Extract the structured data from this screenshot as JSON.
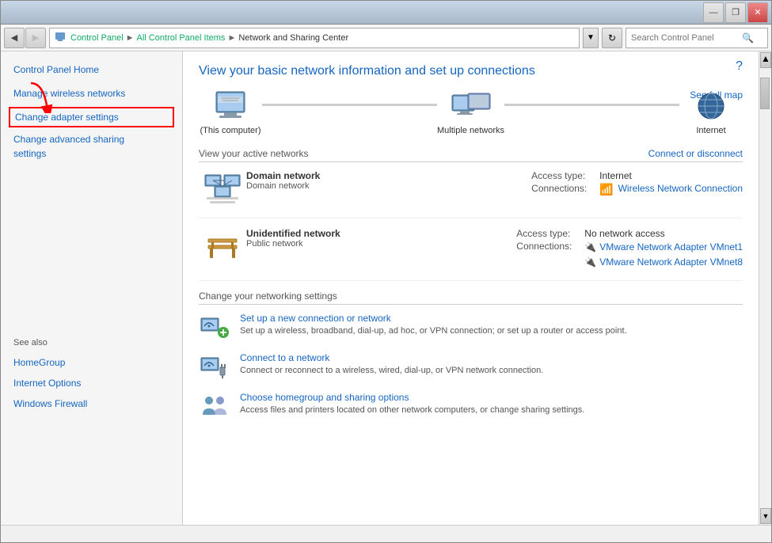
{
  "window": {
    "title": "Network and Sharing Center",
    "buttons": {
      "minimize": "—",
      "maximize": "□",
      "close": "✕",
      "restore": "❐"
    }
  },
  "addressbar": {
    "breadcrumb": [
      "Control Panel",
      "All Control Panel Items",
      "Network and Sharing Center"
    ],
    "search_placeholder": "Search Control Panel"
  },
  "sidebar": {
    "nav_items": [
      {
        "label": "Control Panel Home",
        "id": "control-panel-home"
      },
      {
        "label": "Manage wireless networks",
        "id": "manage-wireless"
      },
      {
        "label": "Change adapter settings",
        "id": "change-adapter",
        "highlighted": true
      },
      {
        "label": "Change advanced sharing\nsettings",
        "id": "change-advanced"
      }
    ],
    "see_also_title": "See also",
    "see_also_items": [
      {
        "label": "HomeGroup",
        "id": "homegroup"
      },
      {
        "label": "Internet Options",
        "id": "internet-options"
      },
      {
        "label": "Windows Firewall",
        "id": "windows-firewall"
      }
    ]
  },
  "content": {
    "title": "View your basic network information and set up connections",
    "see_full_map": "See full map",
    "network_diagram": {
      "items": [
        {
          "label": "(This computer)",
          "type": "computer"
        },
        {
          "label": "Multiple networks",
          "type": "multiple"
        },
        {
          "label": "Internet",
          "type": "internet"
        }
      ]
    },
    "active_networks_header": "View your active networks",
    "connect_or_disconnect": "Connect or disconnect",
    "networks": [
      {
        "name": "Domain network",
        "type": "Domain network",
        "icon": "domain",
        "access_type": "Internet",
        "connection_type": "Wireless Network Connection",
        "connection_icon": "wifi"
      },
      {
        "name": "Unidentified network",
        "type": "Public network",
        "icon": "public",
        "access_type": "No network access",
        "connections": [
          "VMware Network Adapter VMnet1",
          "VMware Network Adapter VMnet8"
        ]
      }
    ],
    "settings_header": "Change your networking settings",
    "settings": [
      {
        "id": "new-connection",
        "link": "Set up a new connection or network",
        "desc": "Set up a wireless, broadband, dial-up, ad hoc, or VPN connection; or set up a router or access point.",
        "icon": "new-connection"
      },
      {
        "id": "connect-network",
        "link": "Connect to a network",
        "desc": "Connect or reconnect to a wireless, wired, dial-up, or VPN network connection.",
        "icon": "connect-network"
      },
      {
        "id": "homegroup-sharing",
        "link": "Choose homegroup and sharing options",
        "desc": "Access files and printers located on other network computers, or change sharing settings.",
        "icon": "homegroup"
      }
    ]
  }
}
